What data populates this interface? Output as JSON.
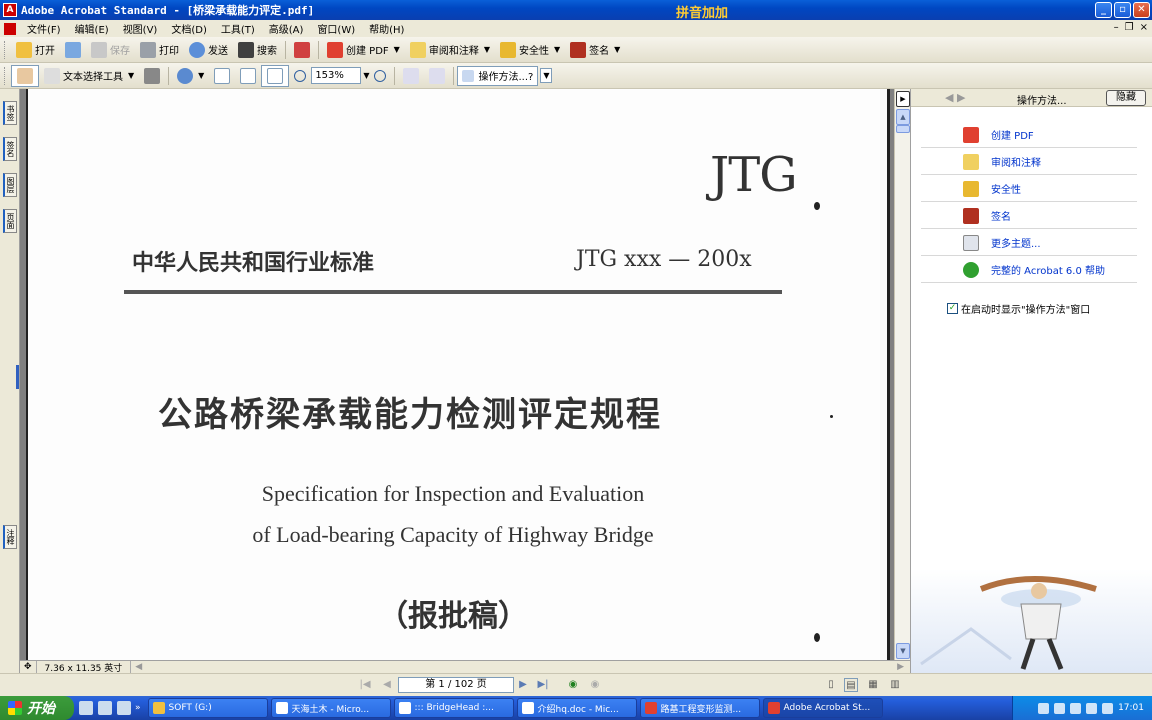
{
  "window": {
    "title": "Adobe Acrobat Standard - [桥梁承载能力评定.pdf]",
    "ime_label": "拼音加加"
  },
  "menu": {
    "items": [
      "文件(F)",
      "编辑(E)",
      "视图(V)",
      "文档(D)",
      "工具(T)",
      "高级(A)",
      "窗口(W)",
      "帮助(H)"
    ]
  },
  "toolbar1": {
    "open": "打开",
    "save": "保存",
    "print": "打印",
    "send": "发送",
    "search": "搜索",
    "create_pdf": "创建 PDF",
    "review": "审阅和注释",
    "security": "安全性",
    "sign": "签名"
  },
  "toolbar2": {
    "text_select": "文本选择工具",
    "zoom_value": "153%",
    "how_to": "操作方法...?"
  },
  "left_tabs": [
    "书签",
    "签名",
    "图层",
    "页面",
    "注释"
  ],
  "document": {
    "logo": "JTG",
    "standard": "中华人民共和国行业标准",
    "code": "JTG xxx — 200x",
    "title_cn": "公路桥梁承载能力检测评定规程",
    "title_en_1": "Specification for Inspection and Evaluation",
    "title_en_2": "of Load-bearing Capacity of Highway Bridge",
    "draft": "（报批稿）"
  },
  "right_panel": {
    "title": "操作方法...",
    "hide": "隐藏",
    "items": [
      "创建 PDF",
      "审阅和注释",
      "安全性",
      "签名",
      "更多主题...",
      "完整的 Acrobat 6.0 帮助"
    ],
    "show_on_start": "在启动时显示\"操作方法\"窗口"
  },
  "status": {
    "page_size": "7.36 x 11.35 英寸",
    "page_indicator": "第 1 / 102 页"
  },
  "taskbar": {
    "start": "开始",
    "tasks": [
      "SOFT (G:)",
      "天海土木 - Micro...",
      "::: BridgeHead :...",
      "介绍hq.doc - Mic...",
      "路基工程变形监测...",
      "Adobe Acrobat St..."
    ],
    "clock": "17:01"
  },
  "colors": {
    "titlebar": "#0047c2",
    "link": "#0033cc",
    "taskbar": "#245edb",
    "start": "#3c9c3c"
  }
}
